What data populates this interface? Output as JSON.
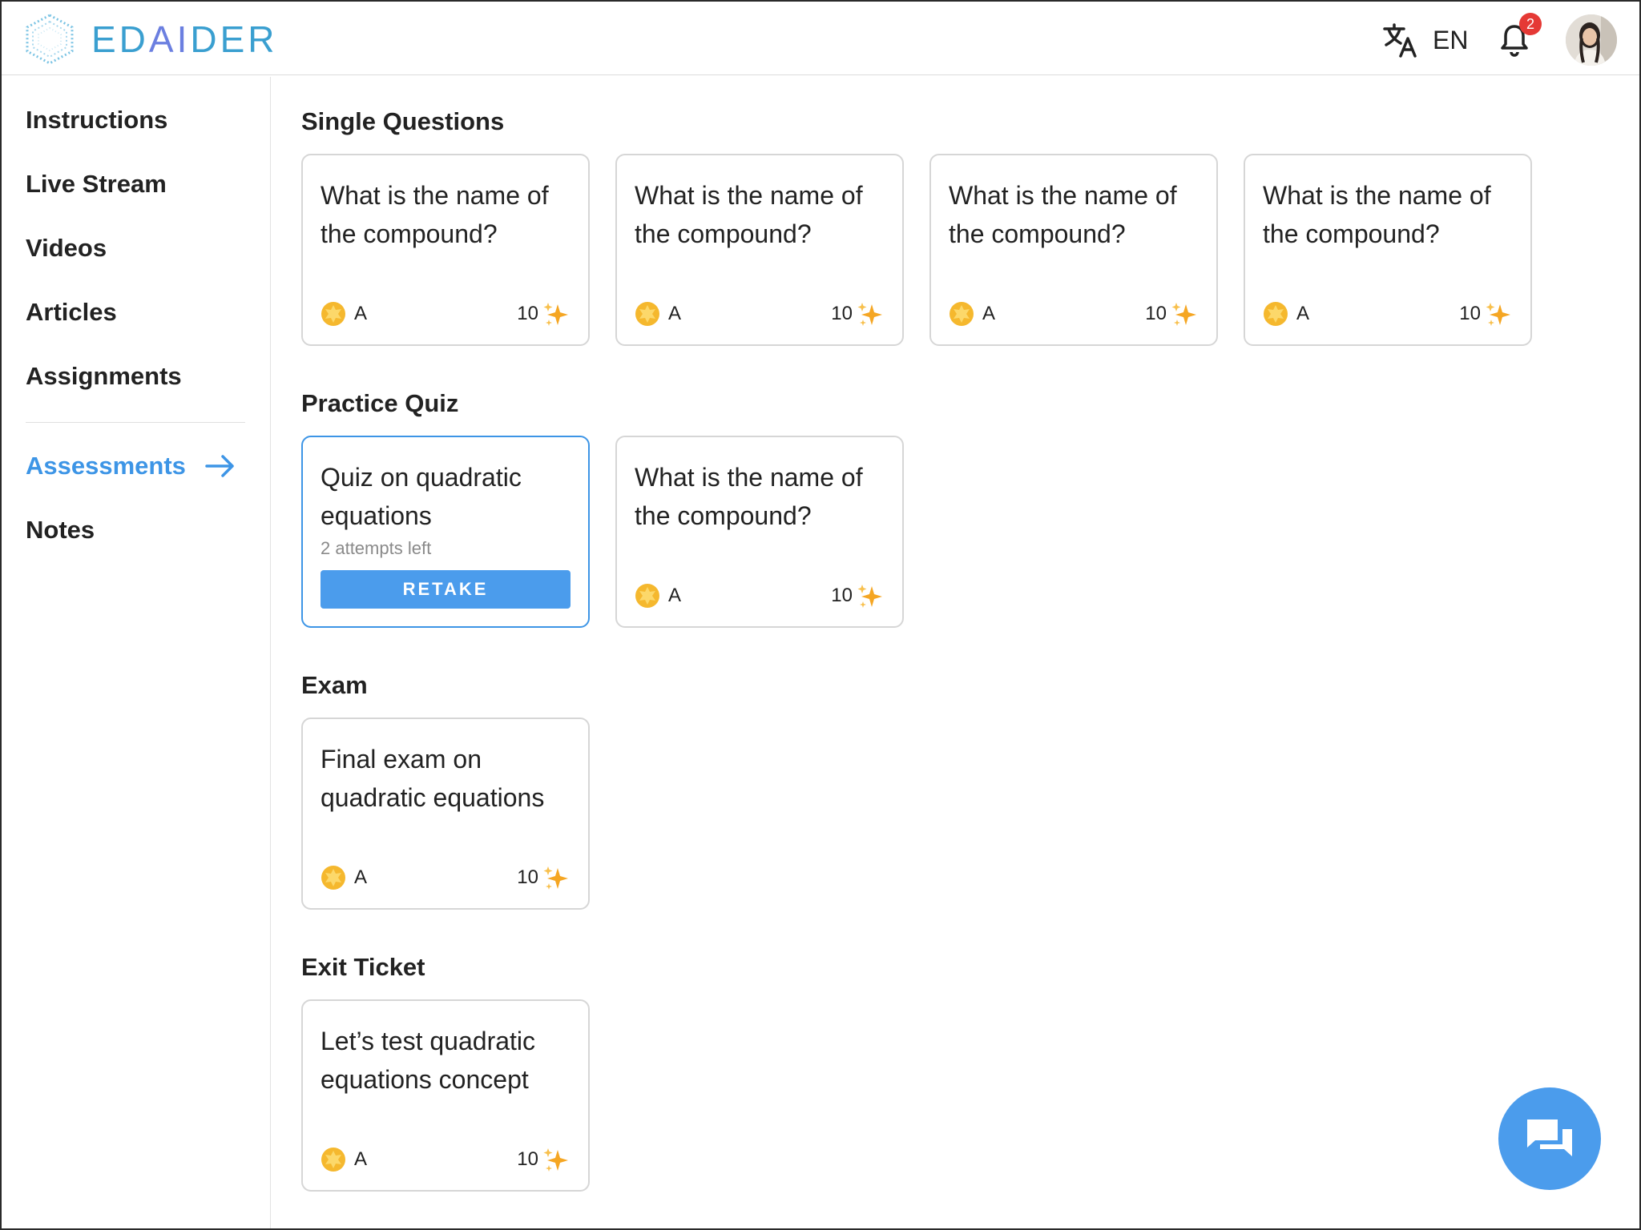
{
  "header": {
    "logo_text_pre": "ED",
    "logo_text_ai": "AI",
    "logo_text_post": "DER",
    "language": "EN",
    "notification_count": "2"
  },
  "sidebar": {
    "items": [
      {
        "label": "Instructions"
      },
      {
        "label": "Live Stream"
      },
      {
        "label": "Videos"
      },
      {
        "label": "Articles"
      },
      {
        "label": "Assignments"
      },
      {
        "label": "Assessments"
      },
      {
        "label": "Notes"
      }
    ],
    "active": "Assessments"
  },
  "sections": {
    "single": {
      "title": "Single Questions",
      "cards": [
        {
          "text": "What is the name of the compound?",
          "grade": "A",
          "points": "10"
        },
        {
          "text": "What is the name of the compound?",
          "grade": "A",
          "points": "10"
        },
        {
          "text": "What is the name of the compound?",
          "grade": "A",
          "points": "10"
        },
        {
          "text": "What is the name of the compound?",
          "grade": "A",
          "points": "10"
        }
      ]
    },
    "practice": {
      "title": "Practice Quiz",
      "quiz": {
        "text": "Quiz on quadratic equations",
        "attempts": "2 attempts left",
        "button": "RETAKE"
      },
      "cards": [
        {
          "text": "What is the name of the compound?",
          "grade": "A",
          "points": "10"
        }
      ]
    },
    "exam": {
      "title": "Exam",
      "cards": [
        {
          "text": "Final exam on quadratic equations",
          "grade": "A",
          "points": "10"
        }
      ]
    },
    "exit": {
      "title": "Exit Ticket",
      "cards": [
        {
          "text": "Let’s test quadratic equations concept",
          "grade": "A",
          "points": "10"
        }
      ]
    }
  },
  "colors": {
    "accent": "#3d95e6",
    "button": "#4b9cec",
    "badge": "#e53935",
    "coin": "#f5b82e",
    "sparkle": "#f5a623"
  },
  "icons": [
    "logo-hexagon",
    "translate-icon",
    "bell-icon",
    "avatar",
    "arrow-right-icon",
    "coin-icon",
    "sparkle-icon",
    "chat-icon"
  ]
}
